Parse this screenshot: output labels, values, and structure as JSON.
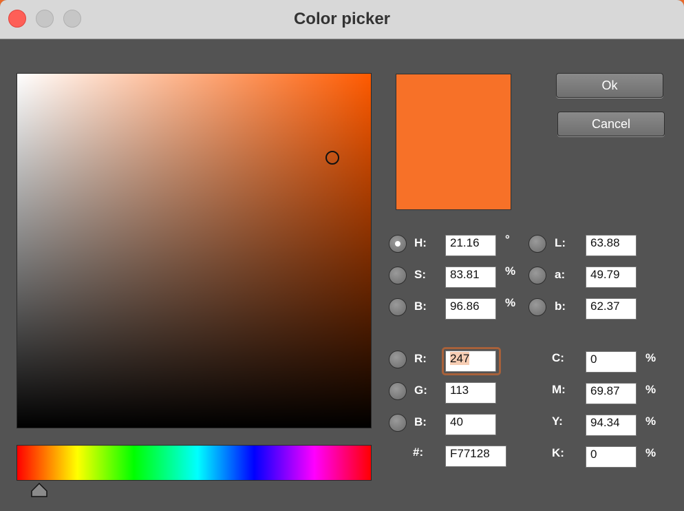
{
  "window": {
    "title": "Color picker"
  },
  "buttons": {
    "ok": "Ok",
    "cancel": "Cancel"
  },
  "colors": {
    "current": "#F77128",
    "background": "#535353"
  },
  "hsb": {
    "h": {
      "label": "H:",
      "value": "21.16",
      "unit": "°",
      "selected": true
    },
    "s": {
      "label": "S:",
      "value": "83.81",
      "unit": "%"
    },
    "b": {
      "label": "B:",
      "value": "96.86",
      "unit": "%"
    }
  },
  "lab": {
    "l": {
      "label": "L:",
      "value": "63.88"
    },
    "a": {
      "label": "a:",
      "value": "49.79"
    },
    "b": {
      "label": "b:",
      "value": "62.37"
    }
  },
  "rgb": {
    "r": {
      "label": "R:",
      "value": "247"
    },
    "g": {
      "label": "G:",
      "value": "113"
    },
    "b": {
      "label": "B:",
      "value": "40"
    },
    "hex": {
      "label": "#:",
      "value": "F77128"
    }
  },
  "cmyk": {
    "c": {
      "label": "C:",
      "value": "0",
      "unit": "%"
    },
    "m": {
      "label": "M:",
      "value": "69.87",
      "unit": "%"
    },
    "y": {
      "label": "Y:",
      "value": "94.34",
      "unit": "%"
    },
    "k": {
      "label": "K:",
      "value": "0",
      "unit": "%"
    }
  },
  "icons": {
    "close": "close-icon",
    "minimize": "minimize-icon",
    "zoom": "zoom-icon",
    "hue_slider": "triangle-slider-icon"
  }
}
